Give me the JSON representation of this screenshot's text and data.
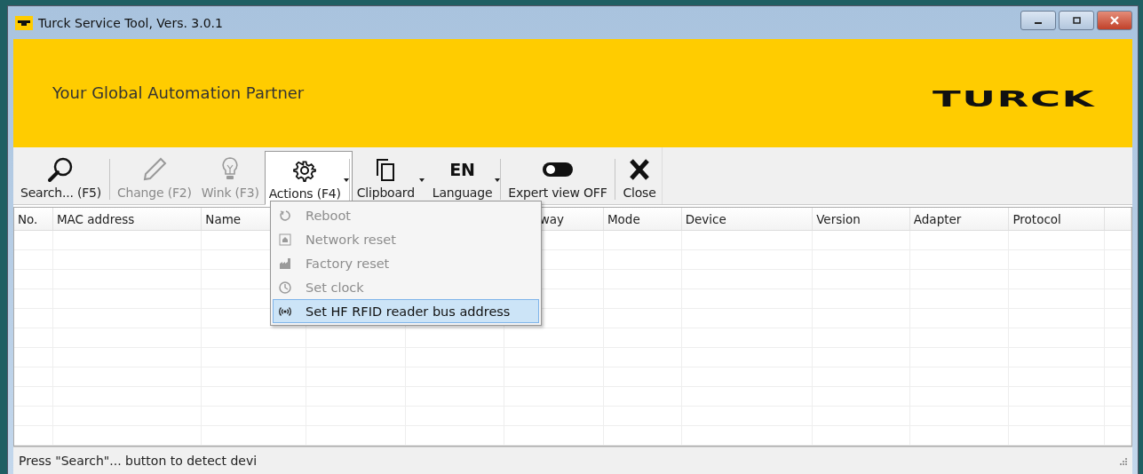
{
  "window": {
    "title": "Turck Service Tool, Vers. 3.0.1"
  },
  "banner": {
    "slogan": "Your Global Automation Partner",
    "logo": "TURCK"
  },
  "toolbar": [
    {
      "kind": "search",
      "label": "Search... (F5)",
      "disabled": false,
      "dropdown": false,
      "open": false,
      "separator_after": true
    },
    {
      "kind": "pencil",
      "label": "Change (F2)",
      "disabled": true,
      "dropdown": false,
      "open": false,
      "separator_after": false
    },
    {
      "kind": "bulb",
      "label": "Wink (F3)",
      "disabled": true,
      "dropdown": false,
      "open": false,
      "separator_after": false
    },
    {
      "kind": "gear",
      "label": "Actions (F4)",
      "disabled": false,
      "dropdown": true,
      "open": true,
      "separator_after": true
    },
    {
      "kind": "copy",
      "label": "Clipboard",
      "disabled": false,
      "dropdown": true,
      "open": false,
      "separator_after": false
    },
    {
      "kind": "text",
      "icon_text": "EN",
      "label": "Language",
      "disabled": false,
      "dropdown": true,
      "open": false,
      "separator_after": true
    },
    {
      "kind": "toggle",
      "label": "Expert view OFF",
      "disabled": false,
      "dropdown": false,
      "open": false,
      "separator_after": true
    },
    {
      "kind": "close",
      "label": "Close",
      "disabled": false,
      "dropdown": false,
      "open": false,
      "separator_after": false
    }
  ],
  "actions_menu": [
    {
      "kind": "reboot",
      "label": "Reboot",
      "disabled": true,
      "selected": false
    },
    {
      "kind": "network",
      "label": "Network reset",
      "disabled": true,
      "selected": false
    },
    {
      "kind": "factory",
      "label": "Factory reset",
      "disabled": true,
      "selected": false
    },
    {
      "kind": "clock",
      "label": "Set clock",
      "disabled": true,
      "selected": false
    },
    {
      "kind": "radio",
      "label": "Set HF RFID reader bus address",
      "disabled": false,
      "selected": true
    }
  ],
  "table": {
    "columns": [
      "No.",
      "MAC address",
      "Name",
      "",
      "",
      "way",
      "Mode",
      "Device",
      "Version",
      "Adapter",
      "Protocol",
      ""
    ]
  },
  "status_bar": {
    "text": "Press \"Search\"... button to detect devi"
  }
}
